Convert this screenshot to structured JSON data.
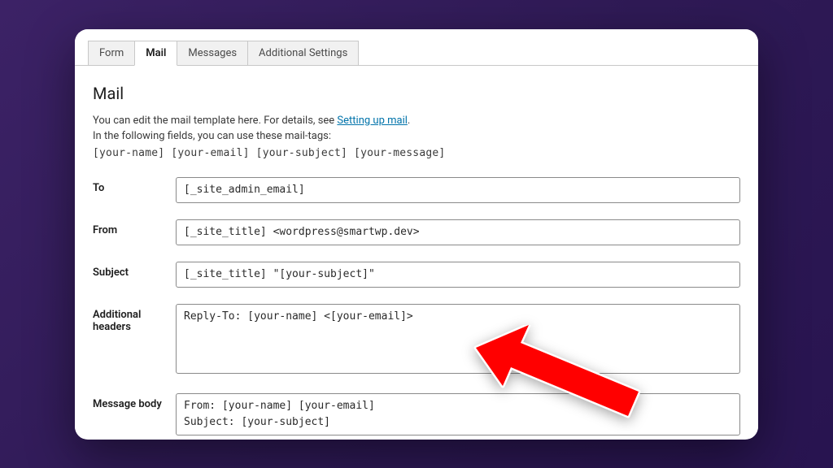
{
  "tabs": {
    "form": "Form",
    "mail": "Mail",
    "messages": "Messages",
    "additional_settings": "Additional Settings"
  },
  "heading": "Mail",
  "desc_text": "You can edit the mail template here. For details, see ",
  "desc_link": "Setting up mail",
  "desc_suffix": ".",
  "tags_intro": "In the following fields, you can use these mail-tags:",
  "tags": "[your-name] [your-email] [your-subject] [your-message]",
  "fields": {
    "to": {
      "label": "To",
      "value": "[_site_admin_email]"
    },
    "from": {
      "label": "From",
      "value": "[_site_title] <wordpress@smartwp.dev>"
    },
    "subject": {
      "label": "Subject",
      "value": "[_site_title] \"[your-subject]\""
    },
    "headers": {
      "label": "Additional headers",
      "value": "Reply-To: [your-name] <[your-email]>"
    },
    "body": {
      "label": "Message body",
      "value": "From: [your-name] [your-email]\nSubject: [your-subject]"
    }
  }
}
